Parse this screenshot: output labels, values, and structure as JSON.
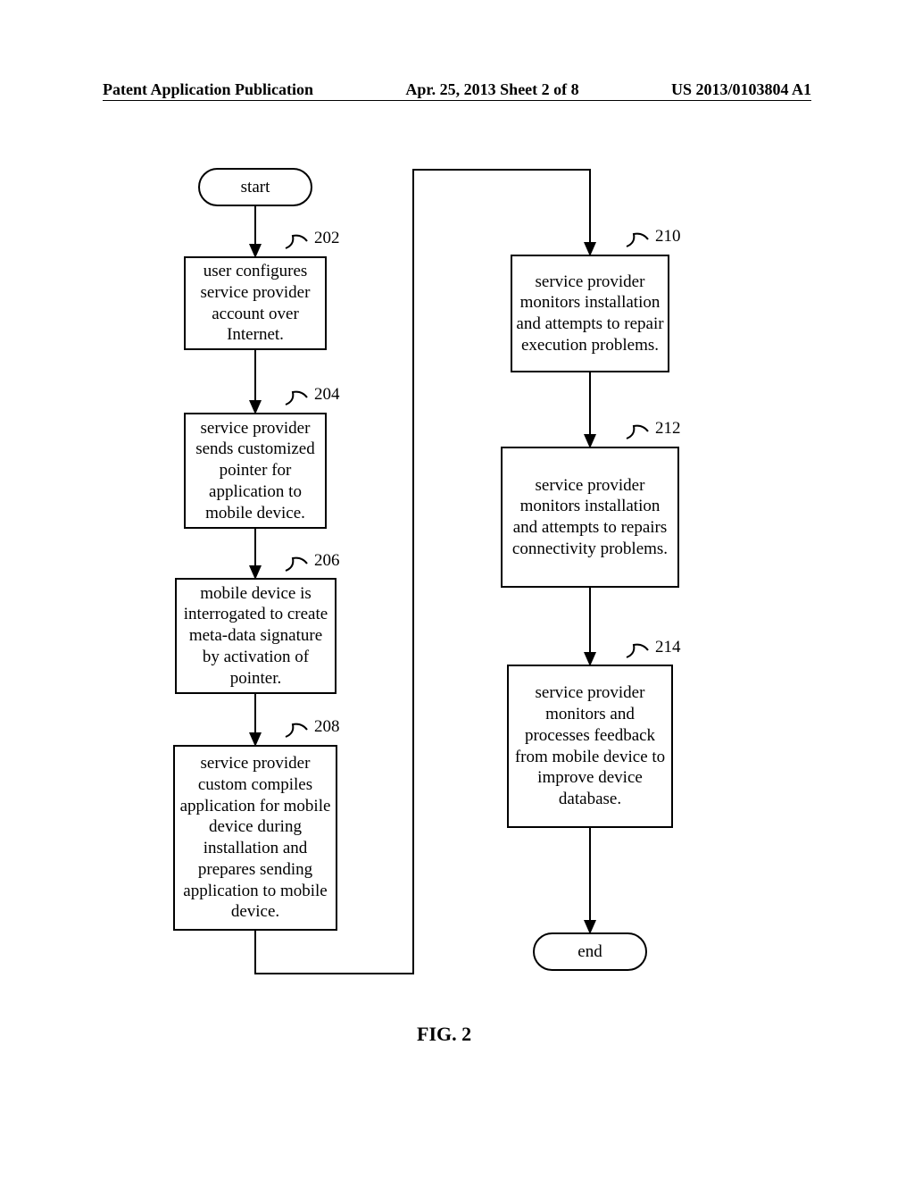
{
  "header": {
    "left": "Patent Application Publication",
    "center": "Apr. 25, 2013  Sheet 2 of 8",
    "right": "US 2013/0103804 A1"
  },
  "figure_label": "FIG. 2",
  "nodes": {
    "start": "start",
    "end": "end",
    "step202": {
      "ref": "202",
      "text": "user configures service provider account over Internet."
    },
    "step204": {
      "ref": "204",
      "text": "service provider sends customized pointer for application to mobile device."
    },
    "step206": {
      "ref": "206",
      "text": "mobile device is interrogated to create meta-data signature by activation of pointer."
    },
    "step208": {
      "ref": "208",
      "text": "service provider custom compiles application for mobile device during installation and prepares sending application to mobile device."
    },
    "step210": {
      "ref": "210",
      "text": "service provider monitors installation and attempts to repair execution problems."
    },
    "step212": {
      "ref": "212",
      "text": "service provider monitors installation and attempts to repairs connectivity problems."
    },
    "step214": {
      "ref": "214",
      "text": "service provider monitors and processes feedback from mobile device to improve device database."
    }
  }
}
